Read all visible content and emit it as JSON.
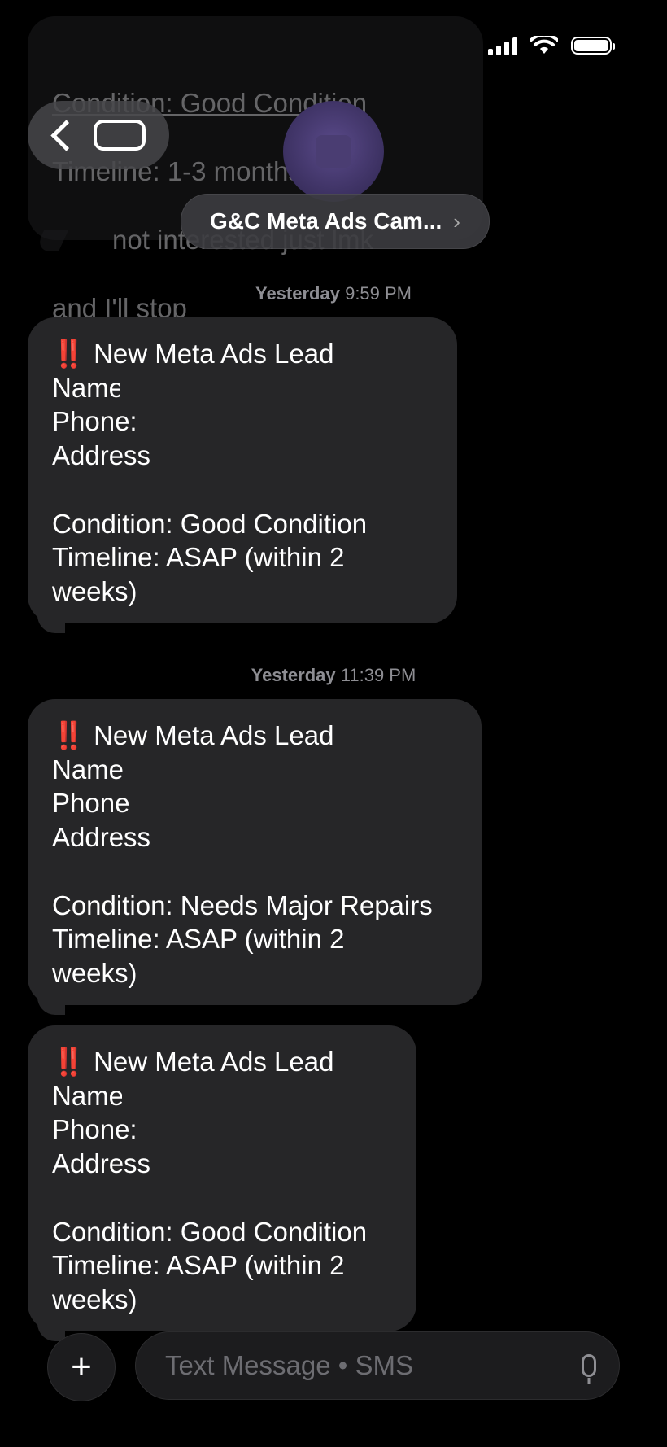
{
  "status_bar": {
    "wifi_icon": "wifi-icon",
    "battery_icon": "battery-icon"
  },
  "previous_message": {
    "lines": [
      "Condition: Good Condition",
      "Timeline: 1-3 months",
      "not interested just lmk",
      "and I'll stop"
    ],
    "reaction": "bull"
  },
  "header": {
    "back_icon": "chevron-left-icon",
    "contact_name": "G&C Meta Ads Cam...",
    "contact_chevron": "›"
  },
  "messages": [
    {
      "timestamp_day": "Yesterday",
      "timestamp_time": "9:59 PM",
      "bangs": "‼️",
      "title": "New Meta Ads Lead",
      "name_label": "Name",
      "phone_label": "Phone:",
      "address_label": "Address",
      "condition": "Condition: Good Condition",
      "timeline_1": "Timeline: ASAP (within 2",
      "timeline_2": "weeks)"
    },
    {
      "timestamp_day": "Yesterday",
      "timestamp_time": "11:39 PM",
      "bangs": "‼️",
      "title": "New Meta Ads Lead",
      "name_label": "Name",
      "phone_label": "Phone",
      "address_label": "Address",
      "condition": "Condition: Needs Major Repairs",
      "timeline_1": "Timeline: ASAP (within 2",
      "timeline_2": "weeks)"
    },
    {
      "bangs": "‼️",
      "title": "New Meta Ads Lead",
      "name_label": "Name",
      "phone_label": "Phone:",
      "address_label": "Address",
      "condition": "Condition: Good Condition",
      "timeline_1": "Timeline: ASAP (within 2",
      "timeline_2": "weeks)"
    }
  ],
  "composer": {
    "placeholder": "Text Message • SMS",
    "plus": "+",
    "mic_icon": "microphone-icon"
  }
}
